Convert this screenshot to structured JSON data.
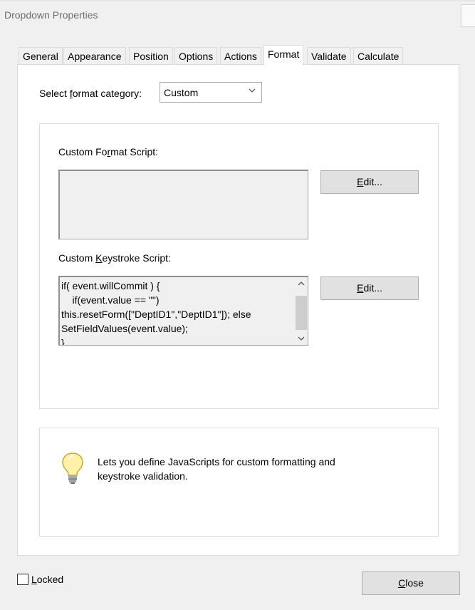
{
  "window": {
    "title": "Dropdown Properties"
  },
  "tabs": [
    {
      "label": "General"
    },
    {
      "label": "Appearance"
    },
    {
      "label": "Position"
    },
    {
      "label": "Options"
    },
    {
      "label": "Actions"
    },
    {
      "label": "Format",
      "active": true
    },
    {
      "label": "Validate"
    },
    {
      "label": "Calculate"
    }
  ],
  "format": {
    "category_label_pre": "Select ",
    "category_label_hotkey": "f",
    "category_label_post": "ormat category:",
    "category_value": "Custom"
  },
  "custom_format": {
    "label_pre": "Custom Fo",
    "label_hotkey": "r",
    "label_post": "mat Script:",
    "edit_hotkey": "E",
    "edit_rest": "dit..."
  },
  "custom_keystroke": {
    "label_pre": "Custom ",
    "label_hotkey": "K",
    "label_post": "eystroke Script:",
    "script_lines": [
      "if( event.willCommit ) {",
      "    if(event.value == \"\")",
      "this.resetForm([\"DeptID1\",\"DeptID1\"]); else",
      "SetFieldValues(event.value);",
      "}"
    ],
    "edit_hotkey": "E",
    "edit_rest": "dit..."
  },
  "info": {
    "line1": "Lets you define JavaScripts for custom formatting and",
    "line2": "keystroke validation."
  },
  "footer": {
    "locked_hotkey": "L",
    "locked_rest": "ocked",
    "close_hotkey": "C",
    "close_rest": "lose"
  }
}
